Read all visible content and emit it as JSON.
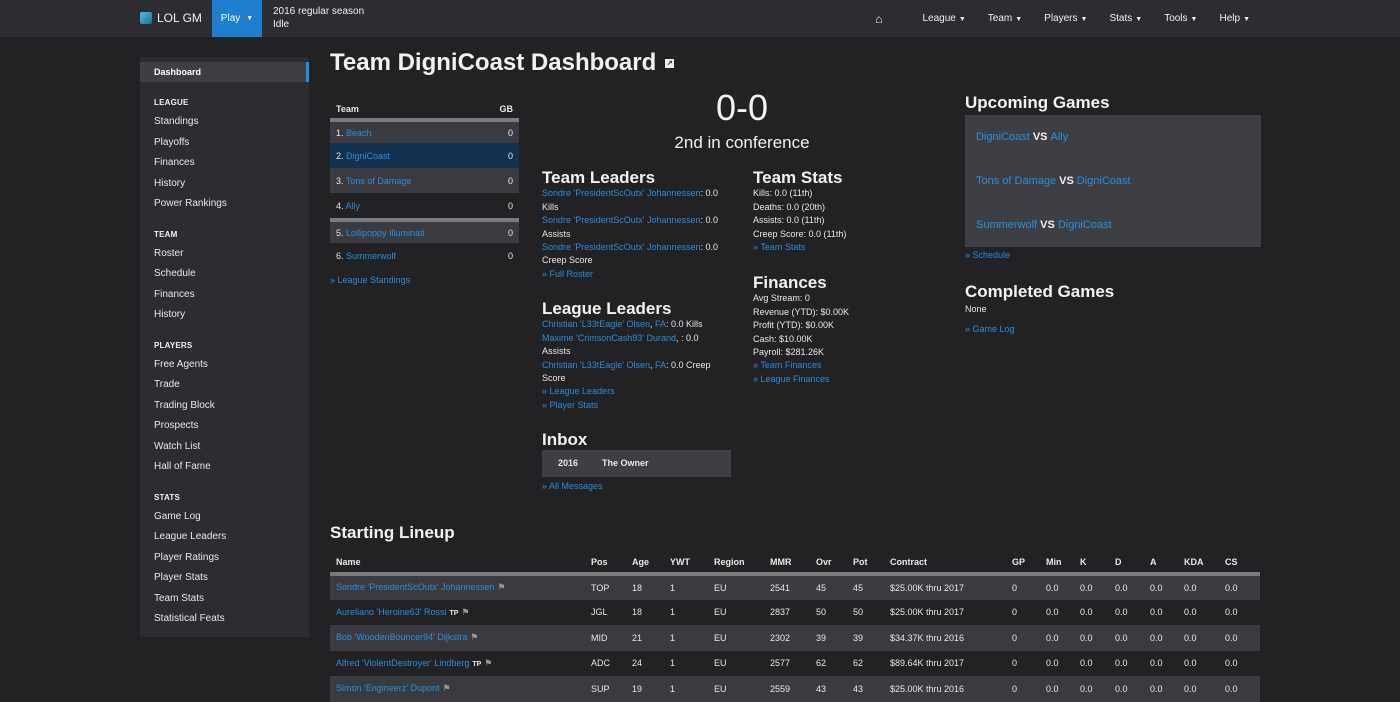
{
  "nav": {
    "brand": "LOL GM",
    "play": "Play",
    "season": "2016 regular season",
    "status": "Idle",
    "menus": [
      "League",
      "Team",
      "Players",
      "Stats",
      "Tools",
      "Help"
    ]
  },
  "sidebar": {
    "active": "Dashboard",
    "sections": [
      {
        "title": "LEAGUE",
        "items": [
          "Standings",
          "Playoffs",
          "Finances",
          "History",
          "Power Rankings"
        ]
      },
      {
        "title": "TEAM",
        "items": [
          "Roster",
          "Schedule",
          "Finances",
          "History"
        ]
      },
      {
        "title": "PLAYERS",
        "items": [
          "Free Agents",
          "Trade",
          "Trading Block",
          "Prospects",
          "Watch List",
          "Hall of Fame"
        ]
      },
      {
        "title": "STATS",
        "items": [
          "Game Log",
          "League Leaders",
          "Player Ratings",
          "Player Stats",
          "Team Stats",
          "Statistical Feats"
        ]
      }
    ]
  },
  "page_title": "Team DigniCoast Dashboard",
  "standings": {
    "col_team": "Team",
    "col_gb": "GB",
    "rows": [
      {
        "rank": "1.",
        "team": "Beach",
        "gb": "0"
      },
      {
        "rank": "2.",
        "team": "DigniCoast",
        "gb": "0"
      },
      {
        "rank": "3.",
        "team": "Tons of Damage",
        "gb": "0"
      },
      {
        "rank": "4.",
        "team": "Ally",
        "gb": "0"
      },
      {
        "rank": "5.",
        "team": "Lollipoppy Illuminati",
        "gb": "0"
      },
      {
        "rank": "6.",
        "team": "Summerwolf",
        "gb": "0"
      }
    ],
    "more": "» League Standings"
  },
  "record": {
    "wl": "0-0",
    "conf": "2nd in conference"
  },
  "team_leaders": {
    "title": "Team Leaders",
    "items": [
      {
        "player": "Sondre 'PresidentScOutx' Johannessen",
        "value": ": 0.0",
        "stat": "Kills"
      },
      {
        "player": "Sondre 'PresidentScOutx' Johannessen",
        "value": ": 0.0",
        "stat": "Assists"
      },
      {
        "player": "Sondre 'PresidentScOutx' Johannessen",
        "value": ": 0.0",
        "stat": "Creep Score"
      }
    ],
    "more": "» Full Roster"
  },
  "team_stats": {
    "title": "Team Stats",
    "lines": [
      "Kills: 0.0 (11th)",
      "Deaths: 0.0 (20th)",
      "Assists: 0.0 (11th)",
      "Creep Score: 0.0 (11th)"
    ],
    "more": "» Team Stats"
  },
  "finances": {
    "title": "Finances",
    "lines": [
      "Avg Stream: 0",
      "Revenue (YTD): $0.00K",
      "Profit (YTD): $0.00K",
      "Cash: $10.00K",
      "Payroll: $281.26K"
    ],
    "links": [
      "» Team Finances",
      "» League Finances"
    ]
  },
  "league_leaders": {
    "title": "League Leaders",
    "items": [
      {
        "player": "Christian 'L33tEagle' Olsen",
        "team": "FA",
        "value": ": 0.0 Kills"
      },
      {
        "player": "Maxime 'CrimsonCash93' Durand",
        "team": "",
        "value": ", : 0.0 Assists"
      },
      {
        "player": "Christian 'L33tEagle' Olsen",
        "team": "FA",
        "value": ": 0.0 Creep Score"
      }
    ],
    "links": [
      "» League Leaders",
      "» Player Stats"
    ]
  },
  "inbox": {
    "title": "Inbox",
    "year": "2016",
    "from": "The Owner",
    "more": "» All Messages"
  },
  "upcoming": {
    "title": "Upcoming Games",
    "games": [
      {
        "home": "DigniCoast",
        "away": "Ally"
      },
      {
        "home": "Tons of Damage",
        "away": "DigniCoast"
      },
      {
        "home": "Summerwolf",
        "away": "DigniCoast"
      }
    ],
    "vs": "VS",
    "more": "» Schedule"
  },
  "completed": {
    "title": "Completed Games",
    "none": "None",
    "more": "» Game Log"
  },
  "lineup": {
    "title": "Starting Lineup",
    "columns": [
      "Name",
      "Pos",
      "Age",
      "YWT",
      "Region",
      "MMR",
      "Ovr",
      "Pot",
      "Contract",
      "GP",
      "Min",
      "K",
      "D",
      "A",
      "KDA",
      "CS"
    ],
    "rows": [
      {
        "name": "Sondre 'PresidentScOutx' Johannessen",
        "tp": "",
        "pos": "TOP",
        "age": "18",
        "ywt": "1",
        "region": "EU",
        "mmr": "2541",
        "ovr": "45",
        "pot": "45",
        "contract": "$25.00K thru 2017",
        "gp": "0",
        "min": "0.0",
        "k": "0.0",
        "d": "0.0",
        "a": "0.0",
        "kda": "0.0",
        "cs": "0.0"
      },
      {
        "name": "Aureliano 'Heroine63' Rossi",
        "tp": "TP",
        "pos": "JGL",
        "age": "18",
        "ywt": "1",
        "region": "EU",
        "mmr": "2837",
        "ovr": "50",
        "pot": "50",
        "contract": "$25.00K thru 2017",
        "gp": "0",
        "min": "0.0",
        "k": "0.0",
        "d": "0.0",
        "a": "0.0",
        "kda": "0.0",
        "cs": "0.0"
      },
      {
        "name": "Bob 'WoodenBouncer94' Dijkstra",
        "tp": "",
        "pos": "MID",
        "age": "21",
        "ywt": "1",
        "region": "EU",
        "mmr": "2302",
        "ovr": "39",
        "pot": "39",
        "contract": "$34.37K thru 2016",
        "gp": "0",
        "min": "0.0",
        "k": "0.0",
        "d": "0.0",
        "a": "0.0",
        "kda": "0.0",
        "cs": "0.0"
      },
      {
        "name": "Alfred 'ViolentDestroyer' Lindberg",
        "tp": "TP",
        "pos": "ADC",
        "age": "24",
        "ywt": "1",
        "region": "EU",
        "mmr": "2577",
        "ovr": "62",
        "pot": "62",
        "contract": "$89.64K thru 2017",
        "gp": "0",
        "min": "0.0",
        "k": "0.0",
        "d": "0.0",
        "a": "0.0",
        "kda": "0.0",
        "cs": "0.0"
      },
      {
        "name": "Simon 'Engineerz' Dupont",
        "tp": "",
        "pos": "SUP",
        "age": "19",
        "ywt": "1",
        "region": "EU",
        "mmr": "2559",
        "ovr": "43",
        "pot": "43",
        "contract": "$25.00K thru 2016",
        "gp": "0",
        "min": "0.0",
        "k": "0.0",
        "d": "0.0",
        "a": "0.0",
        "kda": "0.0",
        "cs": "0.0"
      }
    ]
  },
  "colors": {
    "accent": "#2a8ddb",
    "play_button": "#1e7fd1",
    "background": "#222225",
    "panel": "#2c2d31"
  },
  "icons": {
    "home": "home-icon",
    "external": "external-link-icon",
    "flag": "flag-icon",
    "logo": "logo-icon"
  }
}
